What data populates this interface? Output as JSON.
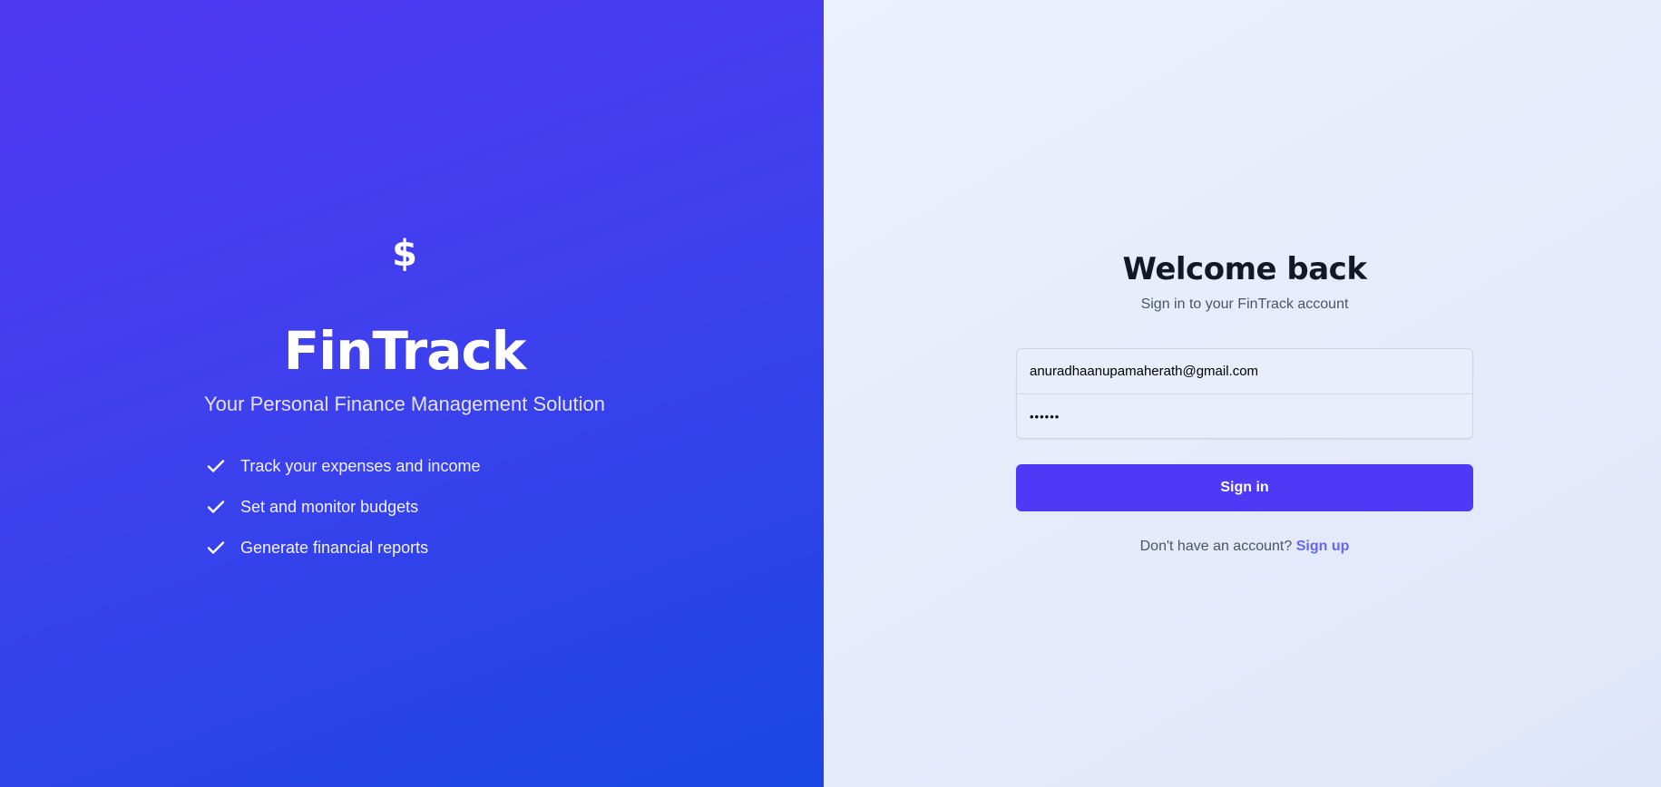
{
  "brand": {
    "icon": "dollar-icon",
    "icon_glyph": "$",
    "name": "FinTrack",
    "tagline": "Your Personal Finance Management Solution"
  },
  "features": [
    {
      "icon": "check-icon",
      "label": "Track your expenses and income"
    },
    {
      "icon": "check-icon",
      "label": "Set and monitor budgets"
    },
    {
      "icon": "check-icon",
      "label": "Generate financial reports"
    }
  ],
  "login": {
    "title": "Welcome back",
    "subtitle": "Sign in to your FinTrack account",
    "email_value": "anuradhaanupamaherath@gmail.com",
    "password_value": "••••••",
    "signin_label": "Sign in",
    "no_account_text": "Don't have an account?",
    "signup_label": "Sign up"
  },
  "colors": {
    "primary": "#4f39f6",
    "link": "#6366f1",
    "panel_gradient_start": "#5038f2",
    "panel_gradient_end": "#1a47e6"
  }
}
